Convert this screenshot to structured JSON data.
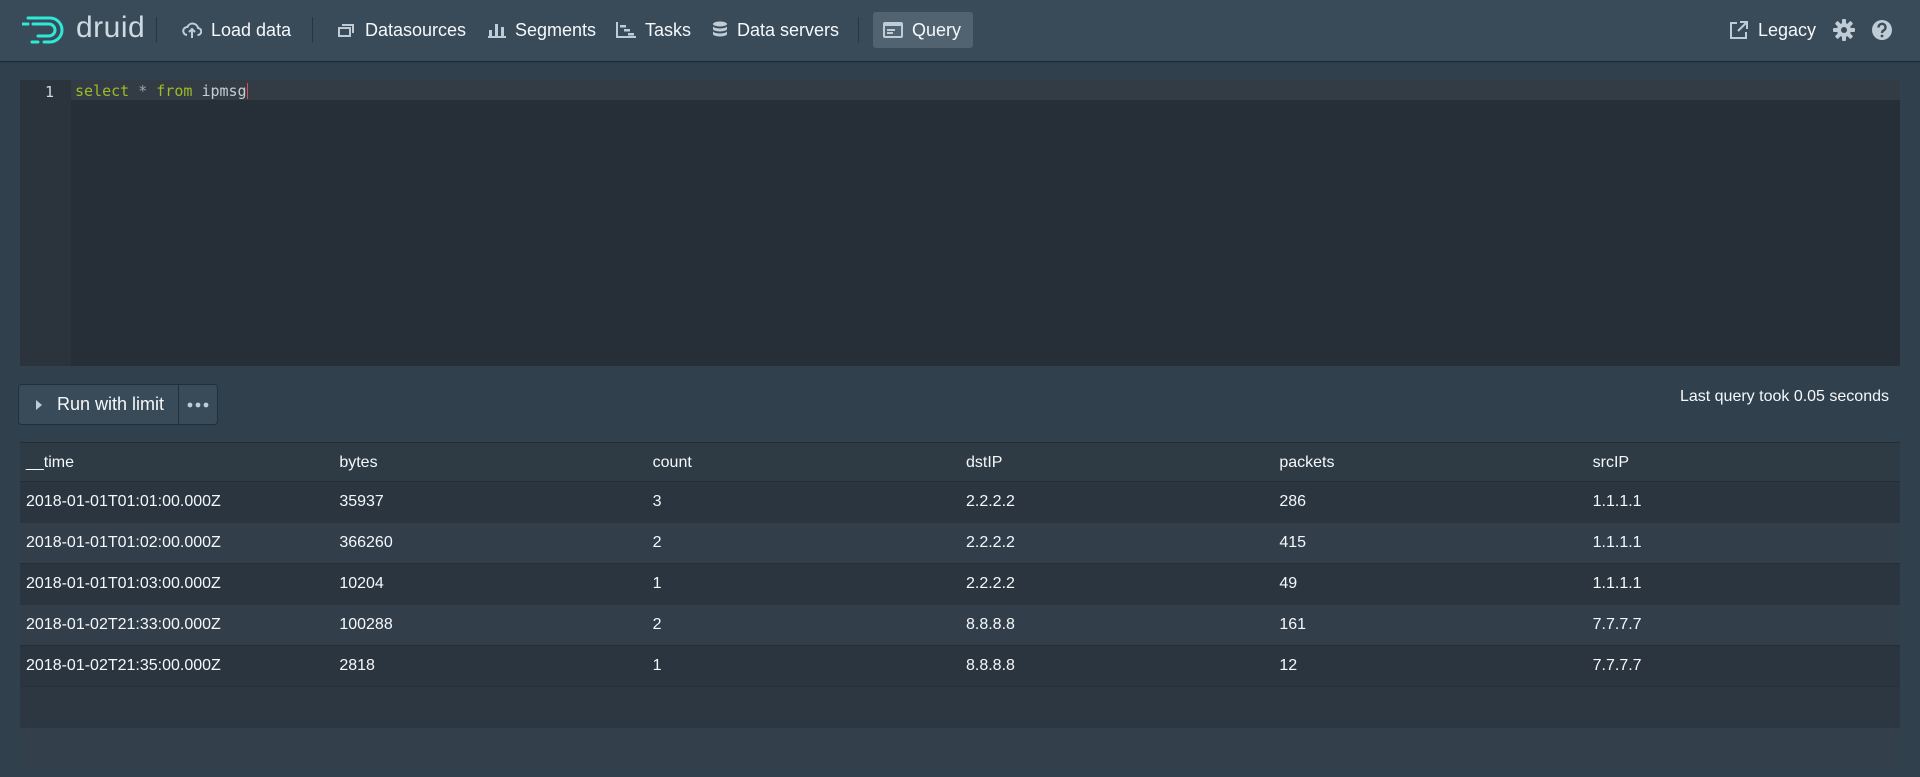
{
  "nav": {
    "brand": "druid",
    "items": [
      {
        "label": "Load data",
        "icon": "cloud-upload-icon"
      },
      {
        "label": "Datasources",
        "icon": "multi-select-icon"
      },
      {
        "label": "Segments",
        "icon": "stacked-chart-icon"
      },
      {
        "label": "Tasks",
        "icon": "gantt-chart-icon"
      },
      {
        "label": "Data servers",
        "icon": "database-icon"
      },
      {
        "label": "Query",
        "icon": "application-icon",
        "active": true
      }
    ],
    "legacy_label": "Legacy",
    "accent_color": "#2ee8d8"
  },
  "editor": {
    "line_number": "1",
    "tokens": {
      "kw1": "select",
      "op": "*",
      "kw2": "from",
      "table": "ipmsg"
    }
  },
  "controls": {
    "run_label": "Run with limit",
    "query_time": "Last query took 0.05 seconds"
  },
  "table": {
    "columns": [
      "__time",
      "bytes",
      "count",
      "dstIP",
      "packets",
      "srcIP"
    ],
    "rows": [
      [
        "2018-01-01T01:01:00.000Z",
        "35937",
        "3",
        "2.2.2.2",
        "286",
        "1.1.1.1"
      ],
      [
        "2018-01-01T01:02:00.000Z",
        "366260",
        "2",
        "2.2.2.2",
        "415",
        "1.1.1.1"
      ],
      [
        "2018-01-01T01:03:00.000Z",
        "10204",
        "1",
        "2.2.2.2",
        "49",
        "1.1.1.1"
      ],
      [
        "2018-01-02T21:33:00.000Z",
        "100288",
        "2",
        "8.8.8.8",
        "161",
        "7.7.7.7"
      ],
      [
        "2018-01-02T21:35:00.000Z",
        "2818",
        "1",
        "8.8.8.8",
        "12",
        "7.7.7.7"
      ]
    ]
  }
}
